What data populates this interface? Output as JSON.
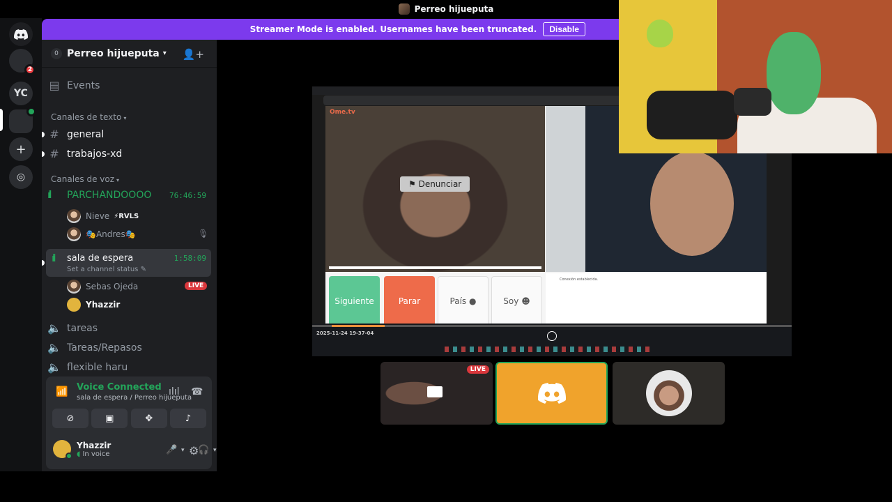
{
  "window": {
    "title": "Perreo hijueputa"
  },
  "rail": {
    "mention_count": "2",
    "server_initials": "YC"
  },
  "banner": {
    "message": "Streamer Mode is enabled. Usernames have been truncated.",
    "button": "Disable"
  },
  "guild": {
    "badge": "0",
    "name": "Perreo hijueputa",
    "events": "Events"
  },
  "text_category": "Canales de texto",
  "text_channels": [
    "general",
    "trabajos-xd"
  ],
  "voice_category": "Canales de voz",
  "voice_channels": {
    "first": {
      "name": "PARCHANDOOOO",
      "timer": "76:46:59",
      "members": [
        "Nieve",
        "Andres"
      ],
      "member_tag": "RVLS"
    },
    "active": {
      "name": "sala de espera",
      "timer": "1:58:09",
      "status": "Set a channel status",
      "members": [
        "Sebas Ojeda",
        "Yhazzir"
      ],
      "live": "LIVE"
    },
    "others": [
      "tareas",
      "Tareas/Repasos",
      "flexible haru"
    ]
  },
  "voice_panel": {
    "title": "Voice Connected",
    "location": "sala de espera / Perreo hijueputa"
  },
  "user": {
    "name": "Yhazzir",
    "status": "In voice"
  },
  "stream": {
    "report_button": "Denunciar",
    "buttons": [
      "Siguiente",
      "Parar",
      "País",
      "Soy"
    ],
    "logo": "Ome.tv",
    "chat_message": "Conexión establecida.",
    "timestamp": "2025-11-24 19-37-04"
  },
  "tiles": {
    "live": "LIVE"
  },
  "colors": {
    "brand": "#5865f2",
    "banner": "#7c3aed",
    "green": "#23a55a",
    "red": "#da373c"
  }
}
